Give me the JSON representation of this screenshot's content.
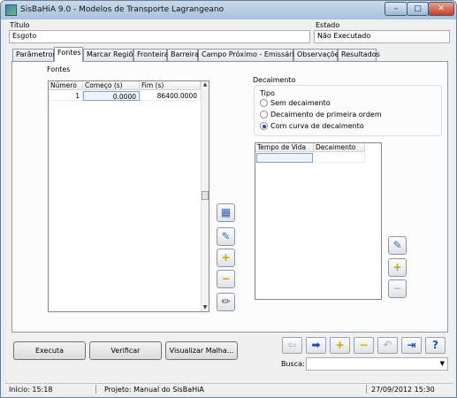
{
  "window": {
    "title": "SisBaHiA 9.0 - Modelos de Transporte Lagrangeano",
    "minimize": "–",
    "maximize": "□",
    "close": "✕"
  },
  "header": {
    "title_label": "Título",
    "title_value": "Esgoto",
    "state_label": "Estado",
    "state_value": "Não Executado"
  },
  "tabs": [
    "Parâmetros",
    "Fontes",
    "Marcar Regiões",
    "Fronteira",
    "Barreira",
    "Campo Próximo - Emissários",
    "Observações",
    "Resultados"
  ],
  "active_tab": "Fontes",
  "fontes": {
    "group_label": "Fontes",
    "columns": [
      "Número",
      "Começo (s)",
      "Fim (s)"
    ],
    "rows": [
      {
        "numero": "1",
        "comeco": "0.0000",
        "fim": "86400.0000"
      }
    ]
  },
  "side_buttons": [
    {
      "icon": "add-source-icon",
      "glyph": "▦"
    },
    {
      "icon": "edit-source-icon",
      "glyph": "✎"
    },
    {
      "icon": "plus-icon",
      "glyph": "+"
    },
    {
      "icon": "minus-icon",
      "glyph": "−"
    },
    {
      "icon": "pencil-icon",
      "glyph": "✏"
    }
  ],
  "decaimento": {
    "group_label": "Decaimento",
    "tipo_label": "Tipo",
    "options": [
      "Sem decaimento",
      "Decaimento de primeira ordem",
      "Com curva de decaimento"
    ],
    "selected": 2,
    "columns": [
      "Tempo de Vida",
      "Decaimento"
    ],
    "buttons": [
      {
        "icon": "edit-table-icon",
        "glyph": "✎"
      },
      {
        "icon": "plus-icon",
        "glyph": "+"
      },
      {
        "icon": "minus-icon",
        "glyph": "−"
      }
    ]
  },
  "actions": {
    "executa": "Executa",
    "verificar": "Verificar",
    "visualizar": "Visualizar Malha..."
  },
  "toolbar": [
    {
      "icon": "back-arrow-icon",
      "glyph": "⇦"
    },
    {
      "icon": "forward-arrow-icon",
      "glyph": "➡"
    },
    {
      "icon": "plus-icon",
      "glyph": "+"
    },
    {
      "icon": "minus-icon",
      "glyph": "−"
    },
    {
      "icon": "undo-icon",
      "glyph": "↶"
    },
    {
      "icon": "exit-icon",
      "glyph": "⇥"
    },
    {
      "icon": "help-icon",
      "glyph": "?"
    }
  ],
  "search": {
    "label": "Busca:",
    "value": ""
  },
  "status": {
    "inicio": "Início: 15:18",
    "projeto": "Projeto: Manual do SisBaHiA",
    "date": "27/09/2012 15:30"
  }
}
